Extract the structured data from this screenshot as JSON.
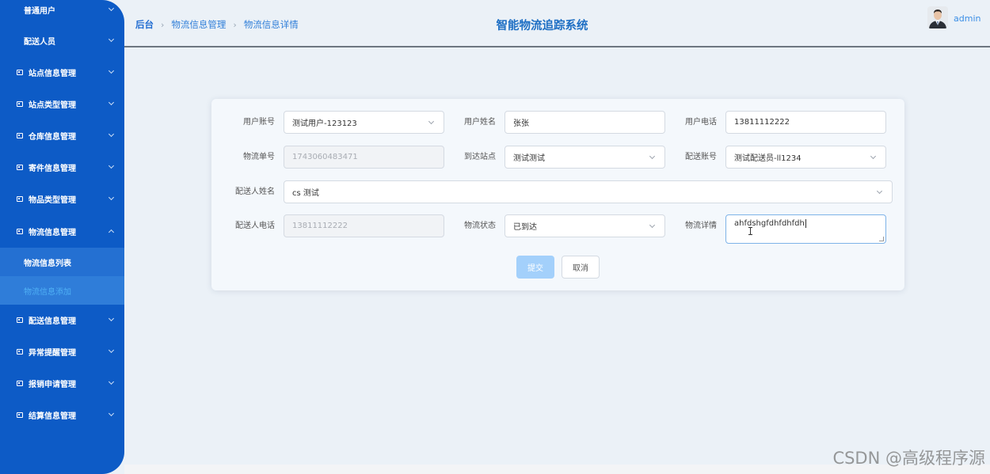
{
  "sidebar": {
    "items": [
      {
        "label": "普通用户",
        "has_icon": false
      },
      {
        "label": "配送人员",
        "has_icon": false
      },
      {
        "label": "站点信息管理",
        "has_icon": true
      },
      {
        "label": "站点类型管理",
        "has_icon": true
      },
      {
        "label": "仓库信息管理",
        "has_icon": true
      },
      {
        "label": "寄件信息管理",
        "has_icon": true
      },
      {
        "label": "物品类型管理",
        "has_icon": true
      },
      {
        "label": "物流信息管理",
        "has_icon": true,
        "expanded": true
      },
      {
        "label": "配送信息管理",
        "has_icon": true
      },
      {
        "label": "异常提醒管理",
        "has_icon": true
      },
      {
        "label": "报销申请管理",
        "has_icon": true
      },
      {
        "label": "结算信息管理",
        "has_icon": true
      }
    ],
    "submenu": [
      {
        "label": "物流信息列表"
      },
      {
        "label": "物流信息添加",
        "active": true
      }
    ]
  },
  "header": {
    "breadcrumb": [
      "后台",
      "物流信息管理",
      "物流信息详情"
    ],
    "title": "智能物流追踪系统",
    "username": "admin"
  },
  "form": {
    "user_account": {
      "label": "用户账号",
      "value": "测试用户-123123"
    },
    "user_name": {
      "label": "用户姓名",
      "value": "张张"
    },
    "user_phone": {
      "label": "用户电话",
      "value": "13811112222"
    },
    "tracking_no": {
      "label": "物流单号",
      "value": "1743060483471"
    },
    "arrival_station": {
      "label": "到达站点",
      "value": "测试测试"
    },
    "courier_account": {
      "label": "配送账号",
      "value": "测试配送员-ll1234"
    },
    "courier_name": {
      "label": "配送人姓名",
      "value": "cs 测试"
    },
    "courier_phone": {
      "label": "配送人电话",
      "value": "13811112222"
    },
    "status": {
      "label": "物流状态",
      "value": "已到达"
    },
    "details": {
      "label": "物流详情",
      "value": "ahfdshgfdhfdhfdh"
    },
    "submit_label": "提交",
    "cancel_label": "取消"
  },
  "watermark": "CSDN @高级程序源",
  "colors": {
    "sidebar_bg": "#0d5bc6",
    "accent": "#1e6fc4",
    "submit_bg": "#a3d0fb"
  }
}
